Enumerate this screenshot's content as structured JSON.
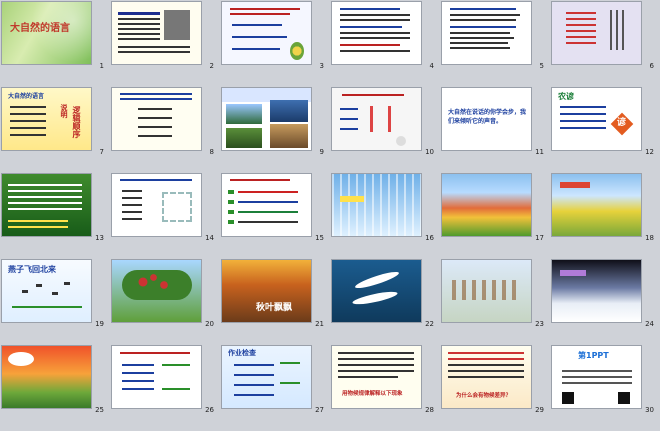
{
  "slides": [
    {
      "num": "1",
      "title": "大自然的语言"
    },
    {
      "num": "2"
    },
    {
      "num": "3"
    },
    {
      "num": "4"
    },
    {
      "num": "5"
    },
    {
      "num": "6"
    },
    {
      "num": "7",
      "title": "大自然的语言",
      "side1": "逻辑顺序",
      "side2": "说明"
    },
    {
      "num": "8"
    },
    {
      "num": "9"
    },
    {
      "num": "10"
    },
    {
      "num": "11",
      "text": "大自然在说话的你学会步，我们来倾听它的声音。"
    },
    {
      "num": "12",
      "title": "农谚",
      "badge": "谚"
    },
    {
      "num": "13"
    },
    {
      "num": "14"
    },
    {
      "num": "15"
    },
    {
      "num": "16"
    },
    {
      "num": "17"
    },
    {
      "num": "18"
    },
    {
      "num": "19",
      "title": "燕子飞回北来"
    },
    {
      "num": "20"
    },
    {
      "num": "21",
      "title": "秋叶飘飘"
    },
    {
      "num": "22"
    },
    {
      "num": "23"
    },
    {
      "num": "24"
    },
    {
      "num": "25"
    },
    {
      "num": "26"
    },
    {
      "num": "27",
      "title": "作业检查"
    },
    {
      "num": "28",
      "text": "用物候规律解释以下现象"
    },
    {
      "num": "29",
      "text": "为什么会有物候差异？"
    },
    {
      "num": "30",
      "title": "第1PPT"
    }
  ]
}
